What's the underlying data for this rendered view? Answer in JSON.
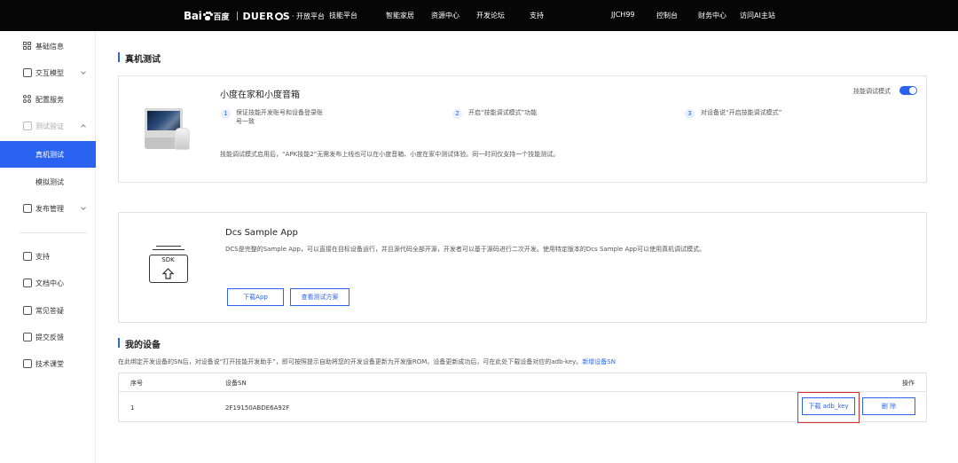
{
  "topbar": {
    "logo": {
      "bai": "Bai",
      "du": "百度",
      "dueros": "DUER",
      "os_s": "S",
      "platform": "· 开放平台"
    },
    "nav_left": [
      "技能平台",
      "智能家居",
      "资源中心",
      "开发论坛",
      "支持"
    ],
    "user": "JJCH99",
    "nav_right": [
      "控制台",
      "财务中心",
      "访问AI主站"
    ]
  },
  "sidebar": {
    "items": [
      {
        "label": "基础信息",
        "icon": "grid-icon"
      },
      {
        "label": "交互模型",
        "icon": "edit-doc-icon"
      },
      {
        "label": "配置服务",
        "icon": "settings-grid-icon"
      },
      {
        "label": "测试验证",
        "icon": "monitor-icon"
      },
      {
        "label": "真机测试"
      },
      {
        "label": "模拟测试"
      },
      {
        "label": "发布管理",
        "icon": "publish-icon"
      },
      {
        "label": "支持",
        "icon": "support-icon"
      },
      {
        "label": "文档中心",
        "icon": "document-icon"
      },
      {
        "label": "常见答疑",
        "icon": "faq-icon"
      },
      {
        "label": "提交反馈",
        "icon": "feedback-icon"
      },
      {
        "label": "技术课堂",
        "icon": "video-icon"
      }
    ]
  },
  "real_device_test": {
    "section_title": "真机测试",
    "card_title": "小度在家和小度音箱",
    "toggle_label": "技能调试模式",
    "toggle_on": true,
    "steps": [
      {
        "num": "1",
        "text": "保证技能开发账号和设备登录账号一致"
      },
      {
        "num": "2",
        "text": "开启“技能调试模式”功能"
      },
      {
        "num": "3",
        "text": "对设备说“开启技能调试模式”"
      }
    ],
    "note": "技能调试模式启用后，“APK技能2”无需发布上线也可以在小度音箱、小度在家中测试体验。同一时间仅支持一个技能测试。"
  },
  "dcs": {
    "title": "Dcs Sample App",
    "icon_text": "SDK",
    "description": "DCS是完整的Sample App，可以直接在目标设备运行，并且源代码全部开源，开发者可以基于源码进行二次开发。使用特定版本的Dcs Sample App可以使用真机调试模式。",
    "download_button": "下载App",
    "view_button": "查看测试方案"
  },
  "my_devices": {
    "section_title": "我的设备",
    "description": "在此绑定开发设备的SN后，对设备说“打开技能开发助手”，即可按照提示自助将您的开发设备更新为开发版ROM。设备更新成功后，可在此处下载设备对应的adb-key。",
    "add_link": "新增设备SN",
    "columns": {
      "index": "序号",
      "sn": "设备SN",
      "actions": "操作"
    },
    "rows": [
      {
        "index": "1",
        "sn": "2F19150ABDE6A92F",
        "download_label": "下载 adb_key",
        "delete_label": "删 除"
      }
    ]
  },
  "colors": {
    "accent": "#2b63f1",
    "topbar": "#060606",
    "highlight": "#d9302f"
  }
}
